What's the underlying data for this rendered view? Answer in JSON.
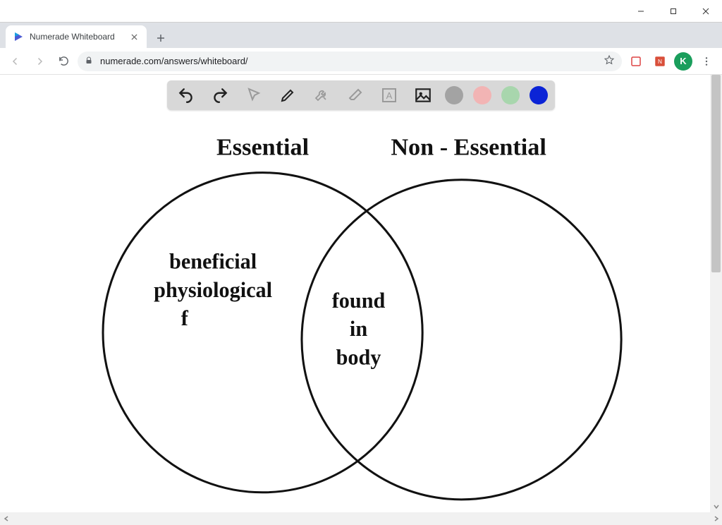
{
  "window": {
    "minimize_tooltip": "Minimize",
    "maximize_tooltip": "Maximize",
    "close_tooltip": "Close"
  },
  "browser": {
    "tab": {
      "title": "Numerade Whiteboard",
      "close_tooltip": "Close tab"
    },
    "newtab_tooltip": "New tab",
    "nav": {
      "back_tooltip": "Back",
      "forward_tooltip": "Forward",
      "reload_tooltip": "Reload"
    },
    "omnibox": {
      "lock_tooltip": "View site information",
      "url": "numerade.com/answers/whiteboard/",
      "star_tooltip": "Bookmark this tab"
    },
    "extensions": {
      "ext1_tooltip": "Extension",
      "ext2_tooltip": "Extension"
    },
    "profile_initial": "K",
    "menu_tooltip": "Customize and control"
  },
  "whiteboard": {
    "tools": {
      "undo": "Undo",
      "redo": "Redo",
      "select": "Select",
      "pen": "Pen",
      "settings": "Tools",
      "eraser": "Eraser",
      "text": "Text",
      "image": "Image"
    },
    "colors": {
      "gray": "#a3a3a3",
      "pink": "#f2b4b4",
      "green": "#a8d6ad",
      "blue": "#0b24d6"
    },
    "content": {
      "left_title": "Essential",
      "right_title": "Non - Essential",
      "left_text_l1": "beneficial",
      "left_text_l2": "physiological",
      "left_text_l3": "f",
      "center_text_l1": "found",
      "center_text_l2": "in",
      "center_text_l3": "body"
    }
  },
  "chart_data": {
    "type": "venn",
    "sets": [
      {
        "name": "Essential",
        "items": [
          "beneficial physiological f"
        ]
      },
      {
        "name": "Non - Essential",
        "items": []
      }
    ],
    "intersection": [
      "found in body"
    ]
  }
}
